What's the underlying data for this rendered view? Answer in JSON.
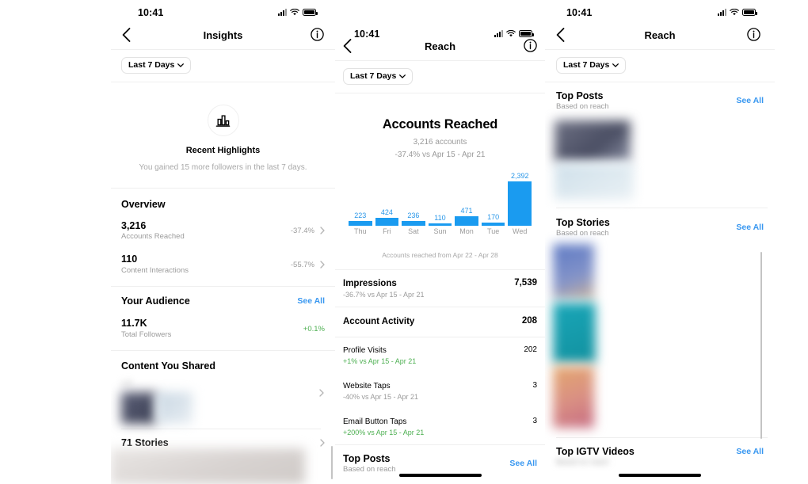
{
  "status_bar": {
    "time": "10:41",
    "cellular_icon": "cellular-signal-icon",
    "wifi_icon": "wifi-icon",
    "battery_icon": "battery-icon"
  },
  "colors": {
    "accent_blue": "#3897f0",
    "bar_blue": "#1a9bf0",
    "positive_green": "#4caf50",
    "muted_gray": "#9b9b9b"
  },
  "panel1": {
    "nav": {
      "title": "Insights",
      "back_icon": "chevron-left-icon",
      "info_icon": "info-circle-icon"
    },
    "filter": {
      "label": "Last 7 Days",
      "chevron_icon": "chevron-down-icon"
    },
    "highlights": {
      "icon": "bar-chart-icon",
      "title": "Recent Highlights",
      "subtitle": "You gained 15 more followers in the last 7 days."
    },
    "overview": {
      "title": "Overview",
      "rows": [
        {
          "value": "3,216",
          "label": "Accounts Reached",
          "delta": "-37.4%",
          "delta_positive": false
        },
        {
          "value": "110",
          "label": "Content Interactions",
          "delta": "-55.7%",
          "delta_positive": false
        }
      ]
    },
    "audience": {
      "title": "Your Audience",
      "see_all": "See All",
      "rows": [
        {
          "value": "11.7K",
          "label": "Total Followers",
          "delta": "+0.1%",
          "delta_positive": true
        }
      ]
    },
    "content_shared": {
      "title": "Content You Shared",
      "rows": [
        {
          "label": "2 P",
          "blurred": true
        },
        {
          "label": "71 Stories",
          "blurred": false
        }
      ]
    }
  },
  "panel2": {
    "nav": {
      "title": "Reach",
      "back_icon": "chevron-left-icon",
      "info_icon": "info-circle-icon"
    },
    "filter": {
      "label": "Last 7 Days",
      "chevron_icon": "chevron-down-icon"
    },
    "heading": {
      "title": "Accounts Reached",
      "accounts": "3,216 accounts",
      "comparison": "-37.4% vs Apr 15 - Apr 21"
    },
    "chart_caption": "Accounts reached from Apr 22 - Apr 28",
    "metrics": [
      {
        "name": "Impressions",
        "sub": "-36.7% vs Apr 15 - Apr 21",
        "value": "7,539",
        "bold": true,
        "sub_positive": false
      },
      {
        "name": "Account Activity",
        "sub": "",
        "value": "208",
        "bold": true,
        "sub_positive": false
      },
      {
        "name": "Profile Visits",
        "sub": "+1% vs Apr 15 - Apr 21",
        "value": "202",
        "bold": false,
        "sub_positive": true
      },
      {
        "name": "Website Taps",
        "sub": "-40% vs Apr 15 - Apr 21",
        "value": "3",
        "bold": false,
        "sub_positive": false
      },
      {
        "name": "Email Button Taps",
        "sub": "+200% vs Apr 15 - Apr 21",
        "value": "3",
        "bold": false,
        "sub_positive": true
      }
    ],
    "top_posts": {
      "title": "Top Posts",
      "subtitle": "Based on reach",
      "see_all": "See All"
    }
  },
  "panel3": {
    "nav": {
      "title": "Reach",
      "back_icon": "chevron-left-icon",
      "info_icon": "info-circle-icon"
    },
    "filter": {
      "label": "Last 7 Days",
      "chevron_icon": "chevron-down-icon"
    },
    "sections": [
      {
        "title": "Top Posts",
        "subtitle": "Based on reach",
        "see_all": "See All"
      },
      {
        "title": "Top Stories",
        "subtitle": "Based on reach",
        "see_all": "See All"
      },
      {
        "title": "Top IGTV Videos",
        "subtitle": "Based on reach",
        "see_all": "See All"
      }
    ]
  },
  "chart_data": {
    "type": "bar",
    "title": "Accounts Reached",
    "categories": [
      "Thu",
      "Fri",
      "Sat",
      "Sun",
      "Mon",
      "Tue",
      "Wed"
    ],
    "values": [
      223,
      424,
      236,
      110,
      471,
      170,
      2392
    ],
    "xlabel": "",
    "ylabel": "Accounts reached",
    "ylim": [
      0,
      2392
    ],
    "caption": "Accounts reached from Apr 22 - Apr 28",
    "grid": false,
    "legend": false,
    "data_labels": [
      "223",
      "424",
      "236",
      "110",
      "471",
      "170",
      "2,392"
    ],
    "bar_color": "#1a9bf0",
    "label_color": "#2896e8"
  }
}
